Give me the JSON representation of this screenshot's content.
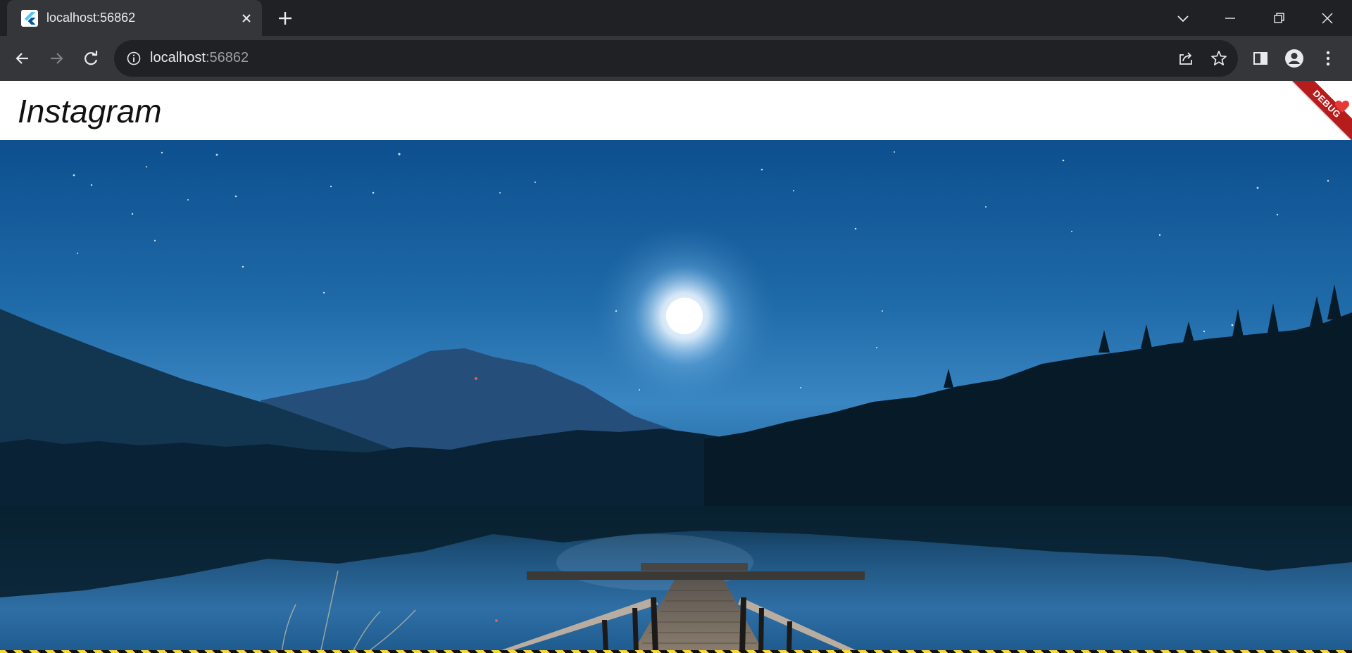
{
  "browser": {
    "tab": {
      "title": "localhost:56862",
      "favicon": "flutter-icon"
    },
    "address": {
      "host": "localhost",
      "port": ":56862"
    },
    "icons": [
      "back-icon",
      "forward-icon",
      "reload-icon",
      "info-icon",
      "share-icon",
      "star-icon",
      "side-panel-icon",
      "profile-icon",
      "menu-icon",
      "tab-search-icon",
      "minimize-icon",
      "restore-icon",
      "close-icon",
      "new-tab-icon"
    ]
  },
  "app": {
    "title": "Instagram",
    "debug_banner": "DEBUG",
    "image": {
      "subject": "moonlit-lake-dock"
    }
  },
  "colors": {
    "chrome_dark": "#202124",
    "chrome_toolbar": "#35363a",
    "debug_red": "#b71c1c",
    "sky_top": "#0d4f8f",
    "sky_mid": "#2f7fc0"
  }
}
